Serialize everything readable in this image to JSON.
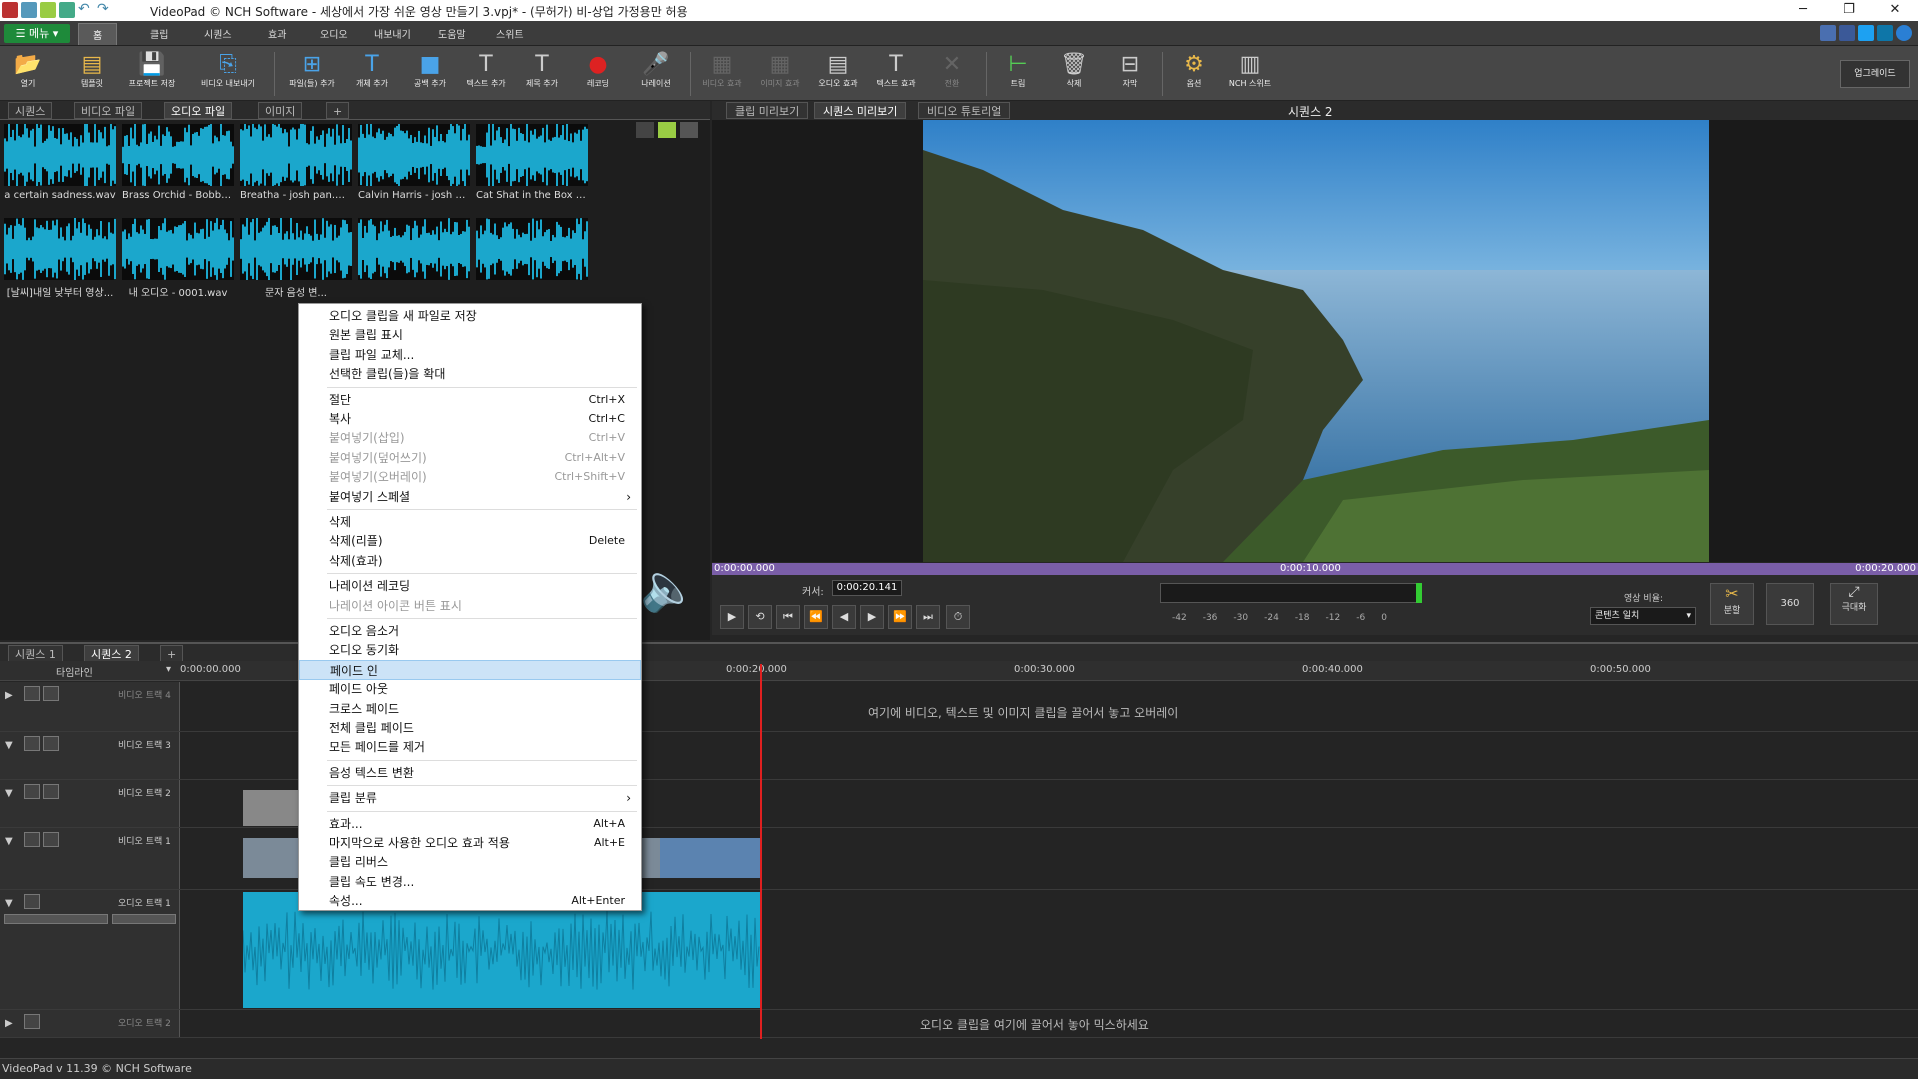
{
  "window": {
    "title": "VideoPad © NCH Software - 세상에서 가장 쉬운 영상 만들기 3.vpj* - (무허가) 비-상업 가정용만 허용"
  },
  "menubar": {
    "menu_label": "메뉴",
    "tabs": [
      "홈",
      "클립",
      "시퀀스",
      "효과",
      "오디오",
      "내보내기",
      "도움말",
      "스위트"
    ]
  },
  "toolbar": {
    "buttons": [
      "열기",
      "템플릿",
      "프로젝트 저장",
      "비디오 내보내기",
      "파일(들) 추가",
      "개체 추가",
      "공백 추가",
      "텍스트 추가",
      "제목 추가",
      "레코딩",
      "나레이션",
      "비디오 효과",
      "이미지 효과",
      "오디오 효과",
      "텍스트 효과",
      "전환",
      "트림",
      "삭제",
      "자막",
      "옵션",
      "NCH 스위트"
    ],
    "upgrade": "업그레이드"
  },
  "bin": {
    "tabs": [
      "시퀀스",
      "비디오 파일",
      "오디오 파일",
      "이미지",
      "+"
    ],
    "items": [
      {
        "label": "a certain sadness.wav"
      },
      {
        "label": "Brass Orchid - Bobby ..."
      },
      {
        "label": "Breatha - josh pan.mp3"
      },
      {
        "label": "Calvin Harris - josh p..."
      },
      {
        "label": "Cat Shat in the Box - J..."
      },
      {
        "label": "[날씨]내일 낮부터 영상..."
      },
      {
        "label": "내 오디오 - 0001.wav"
      },
      {
        "label": "문자 음성 변..."
      },
      {
        "label": ""
      },
      {
        "label": ""
      }
    ]
  },
  "preview": {
    "tabs": [
      "클립 미리보기",
      "시퀀스 미리보기",
      "비디오 튜토리얼"
    ],
    "sequence_name": "시퀀스 2",
    "ruler": [
      "0:00:00.000",
      "0:00:10.000",
      "0:00:20.000"
    ],
    "cursor_label": "커서:",
    "cursor_value": "0:00:20.141",
    "db_scale": [
      "-42",
      "-36",
      "-30",
      "-24",
      "-18",
      "-12",
      "-6",
      "0"
    ],
    "aspect_label": "영상 비율:",
    "aspect_value": "콘텐츠 일치",
    "split_label": "분할",
    "vr_label": "360",
    "maximize_label": "극대화"
  },
  "timeline": {
    "tabs": [
      "시퀀스 1",
      "시퀀스 2",
      "+"
    ],
    "label": "타임라인",
    "ruler": [
      "0:00:00.000",
      "0:00:20.000",
      "0:00:30.000",
      "0:00:40.000",
      "0:00:50.000"
    ],
    "tracks": [
      "비디오 트랙 4",
      "비디오 트랙 3",
      "비디오 트랙 2",
      "비디오 트랙 1",
      "오디오 트랙 1",
      "오디오 트랙 2"
    ],
    "overlay_hint": "여기에 비디오, 텍스트 및 이미지 클립을 끌어서 놓고 오버레이",
    "audio_hint": "오디오 클립을 여기에 끌어서 놓아 믹스하세요"
  },
  "context_menu": {
    "items": [
      {
        "label": "오디오 클립을 새 파일로 저장",
        "shortcut": ""
      },
      {
        "label": "원본 클립 표시",
        "shortcut": ""
      },
      {
        "label": "클립 파일 교체...",
        "shortcut": ""
      },
      {
        "label": "선택한 클립(들)을 확대",
        "shortcut": ""
      },
      {
        "label": "절단",
        "shortcut": "Ctrl+X"
      },
      {
        "label": "복사",
        "shortcut": "Ctrl+C"
      },
      {
        "label": "붙여넣기(삽입)",
        "shortcut": "Ctrl+V"
      },
      {
        "label": "붙여넣기(덮어쓰기)",
        "shortcut": "Ctrl+Alt+V"
      },
      {
        "label": "붙여넣기(오버레이)",
        "shortcut": "Ctrl+Shift+V"
      },
      {
        "label": "붙여넣기 스페셜",
        "shortcut": ""
      },
      {
        "label": "삭제",
        "shortcut": ""
      },
      {
        "label": "삭제(리플)",
        "shortcut": "Delete"
      },
      {
        "label": "삭제(효과)",
        "shortcut": ""
      },
      {
        "label": "나레이션 레코딩",
        "shortcut": ""
      },
      {
        "label": "나레이션 아이콘 버튼 표시",
        "shortcut": ""
      },
      {
        "label": "오디오 음소거",
        "shortcut": ""
      },
      {
        "label": "오디오 동기화",
        "shortcut": ""
      },
      {
        "label": "페이드 인",
        "shortcut": ""
      },
      {
        "label": "페이드 아웃",
        "shortcut": ""
      },
      {
        "label": "크로스 페이드",
        "shortcut": ""
      },
      {
        "label": "전체 클립 페이드",
        "shortcut": ""
      },
      {
        "label": "모든 페이드를 제거",
        "shortcut": ""
      },
      {
        "label": "음성 텍스트 변환",
        "shortcut": ""
      },
      {
        "label": "클립 분류",
        "shortcut": ""
      },
      {
        "label": "효과...",
        "shortcut": "Alt+A"
      },
      {
        "label": "마지막으로 사용한 오디오 효과 적용",
        "shortcut": "Alt+E"
      },
      {
        "label": "클립 리버스",
        "shortcut": ""
      },
      {
        "label": "클립 속도 변경...",
        "shortcut": ""
      },
      {
        "label": "속성...",
        "shortcut": "Alt+Enter"
      }
    ]
  },
  "status": {
    "text": "VideoPad v 11.39 © NCH Software"
  },
  "colors": {
    "accent_green": "#1e8a3a",
    "waveform": "#1ba7cc",
    "playhead": "#e02020",
    "ruler_purple": "#7a5ea8",
    "menu_highlight": "#cce3f7"
  }
}
